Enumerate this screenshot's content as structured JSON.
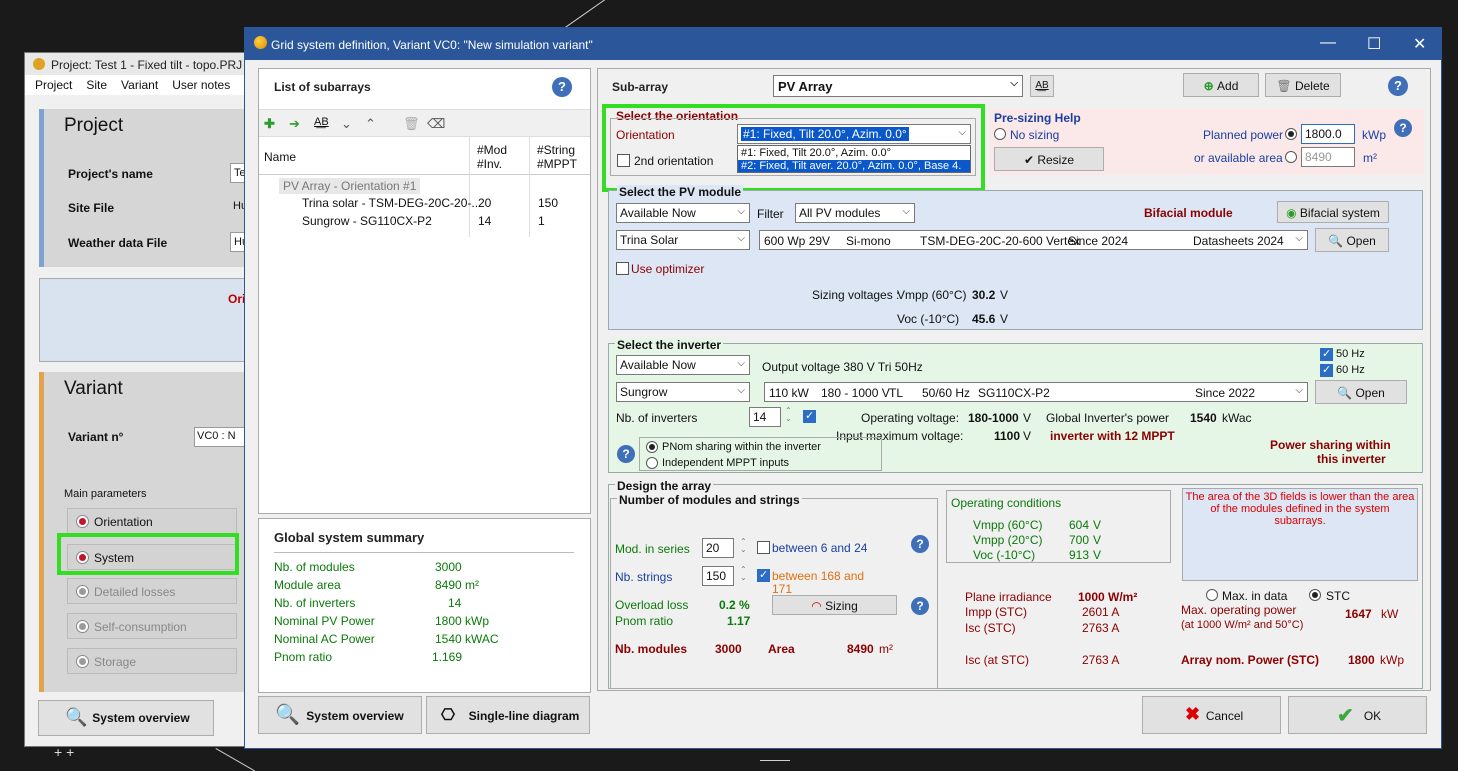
{
  "back_window": {
    "title": "Project:  Test 1 - Fixed tilt - topo.PRJ",
    "menu": [
      "Project",
      "Site",
      "Variant",
      "User notes"
    ],
    "project_header": "Project",
    "project_name_label": "Project's name",
    "project_name_value": "Tes",
    "site_file_label": "Site File",
    "site_file_value": "Hue",
    "weather_label": "Weather data File",
    "weather_value": "Hue",
    "orient_fragment": "Ori",
    "variant_header": "Variant",
    "variant_no_label": "Variant n°",
    "variant_no_value": "VC0       : N",
    "main_params_label": "Main parameters",
    "params": [
      "Orientation",
      "System",
      "Detailed losses",
      "Self-consumption",
      "Storage"
    ],
    "system_overview_btn": "System overview"
  },
  "dialog": {
    "title": "Grid system definition, Variant VC0:   \"New simulation variant\"",
    "win_min": "—",
    "win_max": "☐",
    "win_close": "✕"
  },
  "subarrays": {
    "title": "List of subarrays",
    "col_name": "Name",
    "col_mod": "#Mod\n#Inv.",
    "col_string": "#String\n#MPPT",
    "group": "PV Array - Orientation #1",
    "rows": [
      {
        "name": "Trina solar - TSM-DEG-20C-20-...",
        "mod": "20",
        "str": "150"
      },
      {
        "name": "Sungrow - SG110CX-P2",
        "mod": "14",
        "str": "1"
      }
    ]
  },
  "summary": {
    "title": "Global system summary",
    "rows": [
      {
        "label": "Nb. of modules",
        "value": "3000",
        "unit": ""
      },
      {
        "label": "Module area",
        "value": "8490",
        "unit": "m²"
      },
      {
        "label": "Nb. of inverters",
        "value": "14",
        "unit": ""
      },
      {
        "label": "Nominal PV Power",
        "value": "1800",
        "unit": "kWp"
      },
      {
        "label": "Nominal AC Power",
        "value": "1540",
        "unit": "kWAC"
      },
      {
        "label": "Pnom ratio",
        "value": "1.169",
        "unit": ""
      }
    ]
  },
  "bottom_left": {
    "system_overview": "System overview",
    "single_line": "Single-line diagram"
  },
  "subarray_bar": {
    "label": "Sub-array",
    "value": "PV Array",
    "add": "Add",
    "delete": "Delete"
  },
  "orientation": {
    "title": "Select the orientation",
    "label": "Orientation",
    "selected": "#1: Fixed, Tilt 20.0°, Azim. 0.0°",
    "options": [
      "#1: Fixed, Tilt 20.0°, Azim. 0.0°",
      "#2: Fixed, Tilt aver. 20.0°, Azim. 0.0°, Base 4."
    ],
    "second": "2nd orientation"
  },
  "presizing": {
    "title": "Pre-sizing Help",
    "no_sizing": "No sizing",
    "resize": "Resize",
    "planned_power_label": "Planned power",
    "planned_power": "1800.0",
    "planned_power_unit": "kWp",
    "area_label": "or available area",
    "area": "8490",
    "area_unit": "m²"
  },
  "pv_module": {
    "title": "Select the PV module",
    "availability": "Available Now",
    "filter_label": "Filter",
    "filter": "All PV modules",
    "bifacial_label": "Bifacial module",
    "bifacial_btn": "Bifacial system",
    "manufacturer": "Trina Solar",
    "model_power": "600 Wp 29V",
    "model_tech": "Si-mono",
    "model_name": "TSM-DEG-20C-20-600 Vertex",
    "model_since": "Since 2024",
    "model_source": "Datasheets 2024",
    "open": "Open",
    "optimizer": "Use optimizer",
    "sizing_label": "Sizing voltages :",
    "vmpp_label": "Vmpp (60°C)",
    "vmpp": "30.2",
    "voc_label": "Voc (-10°C)",
    "voc": "45.6",
    "volt_unit": "V"
  },
  "inverter": {
    "title": "Select the inverter",
    "availability": "Available Now",
    "output_voltage": "Output voltage 380 V Tri 50Hz",
    "hz50": "50 Hz",
    "hz60": "60 Hz",
    "manufacturer": "Sungrow",
    "model_power": "110 kW",
    "model_range": "180 - 1000 V",
    "model_tl": "TL",
    "model_hz": "50/60 Hz",
    "model_name": "SG110CX-P2",
    "model_since": "Since 2022",
    "open": "Open",
    "nb_label": "Nb. of inverters",
    "nb": "14",
    "op_voltage_label": "Operating voltage:",
    "op_voltage": "180-1000",
    "max_voltage_label": "Input maximum voltage:",
    "max_voltage": "1100",
    "v": "V",
    "global_power_label": "Global Inverter's power",
    "global_power": "1540",
    "global_power_unit": "kWac",
    "mppt_note": "inverter with 12 MPPT",
    "pnom_sharing": "PNom sharing within the inverter",
    "independent": "Independent MPPT inputs",
    "power_sharing_1": "Power sharing within",
    "power_sharing_2": "this inverter"
  },
  "design": {
    "title": "Design the array",
    "sub_title": "Number of modules and strings",
    "mod_series_label": "Mod. in series",
    "mod_series": "20",
    "between_series": "between 6 and 24",
    "nb_strings_label": "Nb. strings",
    "nb_strings": "150",
    "between_strings_1": "between 168 and",
    "between_strings_2": "171",
    "overload_label": "Overload loss",
    "overload": "0.2 %",
    "pnom_ratio_label": "Pnom ratio",
    "pnom_ratio": "1.17",
    "sizing_btn": "Sizing",
    "nb_modules_label": "Nb. modules",
    "nb_modules": "3000",
    "area_label": "Area",
    "area": "8490",
    "area_unit": "m²",
    "op_cond_title": "Operating conditions",
    "op_cond": [
      {
        "label": "Vmpp (60°C)",
        "value": "604",
        "unit": "V"
      },
      {
        "label": "Vmpp (20°C)",
        "value": "700",
        "unit": "V"
      },
      {
        "label": "Voc (-10°C)",
        "value": "913",
        "unit": "V"
      }
    ],
    "warning": "The area of the 3D fields is lower than the area of the modules defined in the system subarrays.",
    "plane_irr_label": "Plane irradiance",
    "plane_irr": "1000",
    "plane_irr_unit": "W/m²",
    "impp_label": "Impp (STC)",
    "impp": "2601 A",
    "isc_label": "Isc (STC)",
    "isc": "2763 A",
    "isc_at_label": "Isc (at STC)",
    "isc_at": "2763 A",
    "max_in_data": "Max. in data",
    "stc": "STC",
    "max_op_power_label": "Max. operating power",
    "max_op_power_sub": "(at 1000 W/m²  and 50°C)",
    "max_op_power": "1647",
    "max_op_power_unit": "kW",
    "array_nom_label": "Array nom. Power (STC)",
    "array_nom": "1800",
    "array_nom_unit": "kWp"
  },
  "footer": {
    "cancel": "Cancel",
    "ok": "OK"
  },
  "colors": {
    "title_bar": "#2b579a",
    "highlight": "#33dd22",
    "pv_bg": "#dce6f4",
    "inverter_bg": "#e6f6e6",
    "presizing_bg": "#fbe9e9"
  }
}
